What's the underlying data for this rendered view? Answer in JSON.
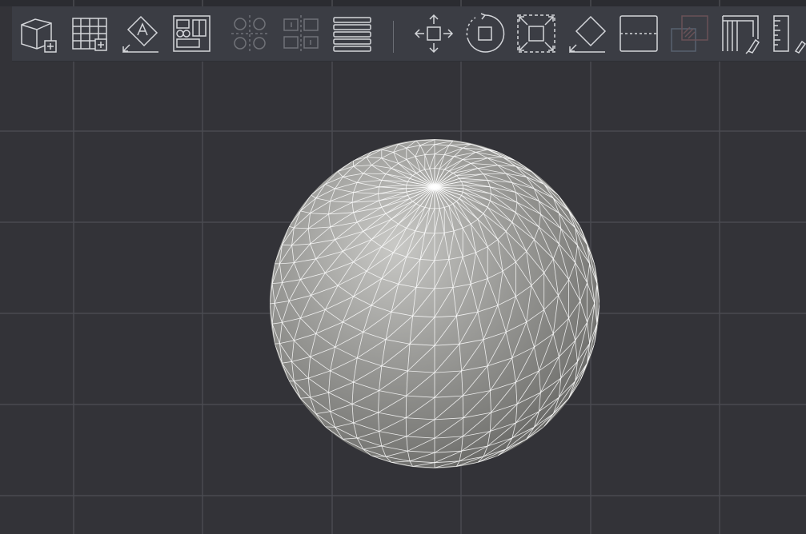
{
  "app": {
    "background": "#333338",
    "accent_stroke": "#d4d6da",
    "grid_color": "#4a4b51",
    "mesh_color": "#ffffff"
  },
  "toolbar": {
    "items": [
      {
        "name": "add-box-icon",
        "enabled": true
      },
      {
        "name": "add-grid-icon",
        "enabled": true
      },
      {
        "name": "place-text-icon",
        "enabled": true
      },
      {
        "name": "layout-panel-icon",
        "enabled": true
      },
      {
        "name": "distribute-circles-icon",
        "enabled": false
      },
      {
        "name": "split-panels-icon",
        "enabled": false
      },
      {
        "name": "stack-lines-icon",
        "enabled": true
      },
      {
        "name": "move-arrows-icon",
        "enabled": true
      },
      {
        "name": "rotate-icon",
        "enabled": true
      },
      {
        "name": "scale-frame-icon",
        "enabled": true
      },
      {
        "name": "eraser-icon",
        "enabled": true
      },
      {
        "name": "section-plane-icon",
        "enabled": true
      },
      {
        "name": "overlay-layers-icon",
        "enabled": false
      },
      {
        "name": "paint-wall-icon",
        "enabled": true
      },
      {
        "name": "measure-ruler-icon",
        "enabled": true
      }
    ]
  },
  "scene": {
    "object": "sphere-mesh",
    "shading": "gray",
    "wireframe": true
  }
}
